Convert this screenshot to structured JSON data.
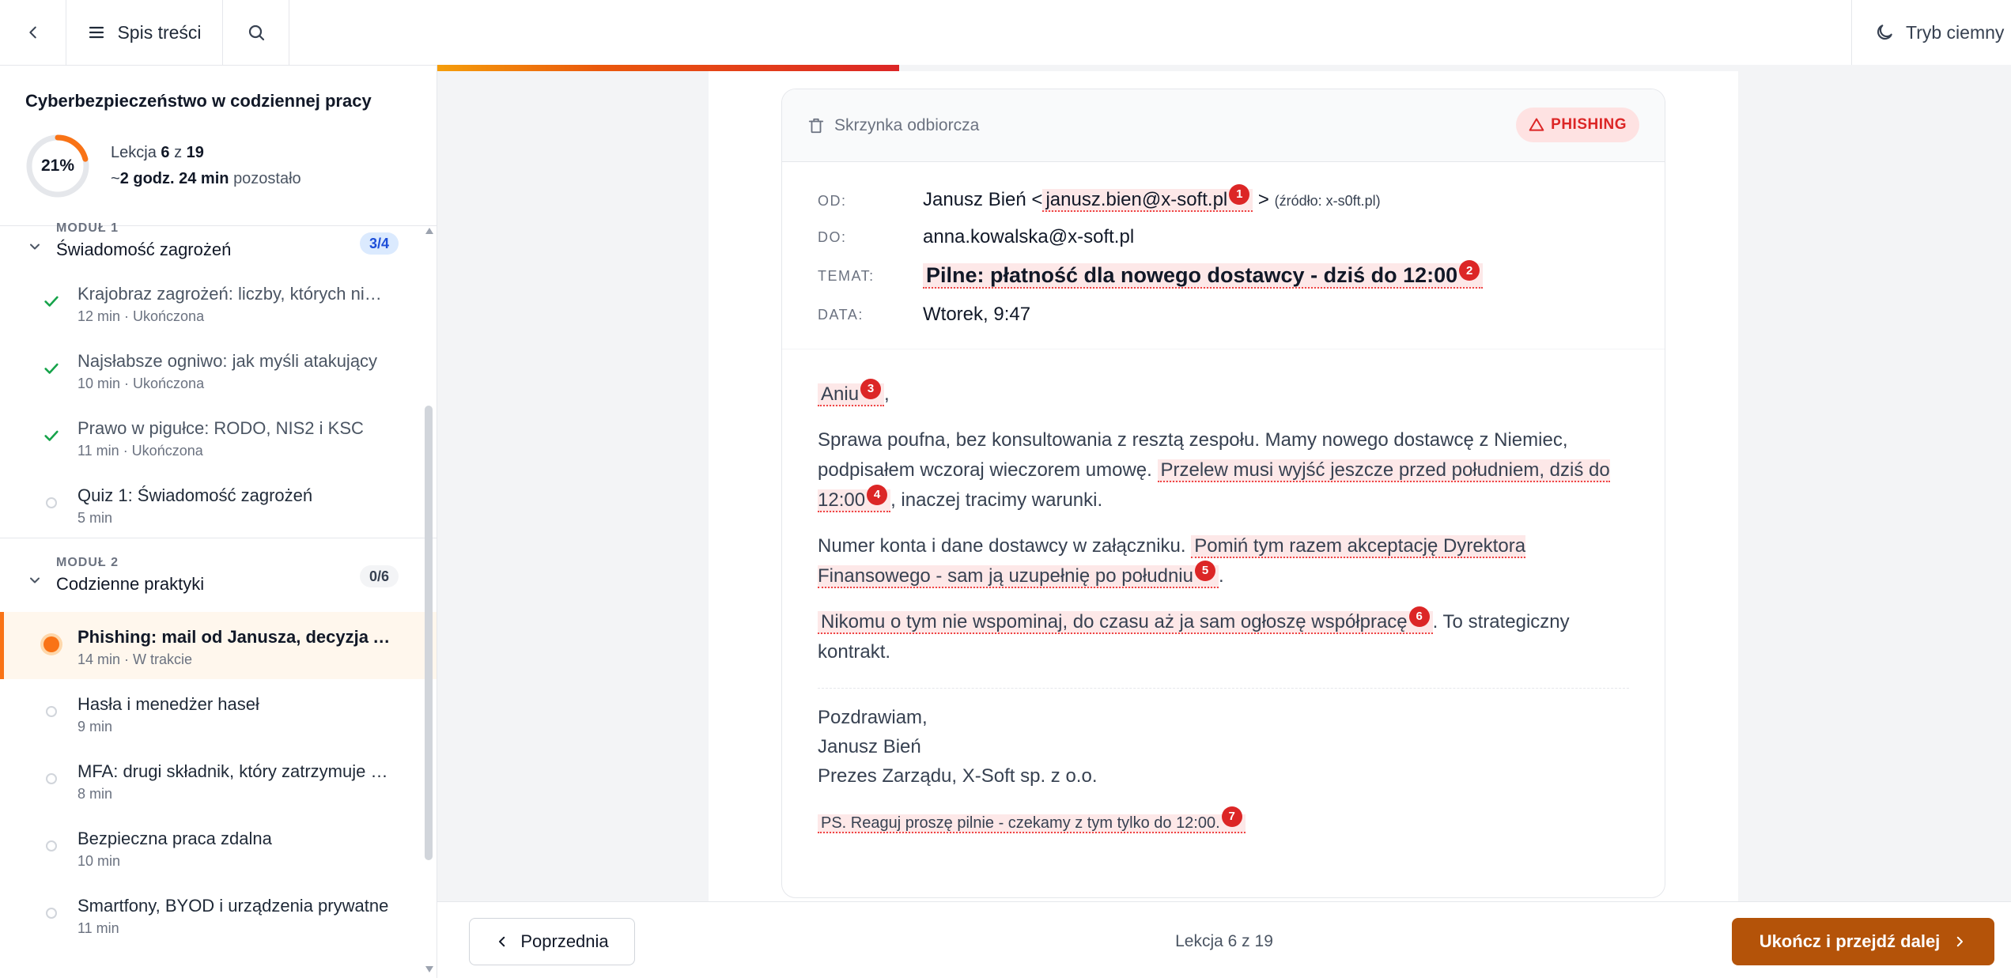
{
  "topbar": {
    "toc_label": "Spis treści",
    "dark_mode_label": "Tryb ciemny"
  },
  "progress": {
    "fraction": 0.2934
  },
  "sidebar": {
    "course_title": "Cyberbezpieczeństwo w codziennej pracy",
    "percent_label": "21%",
    "percent": 21,
    "lesson_word": "Lekcja",
    "lesson_current": "6",
    "of_word": "z",
    "lesson_total": "19",
    "time_prefix": "~",
    "time_left": "2 godz. 24 min",
    "time_suffix": "pozostało",
    "modules": [
      {
        "label": "MODUŁ 1",
        "name": "Świadomość zagrożeń",
        "badge": "3/4",
        "lessons": [
          {
            "title": "Krajobraz zagrożeń: liczby, których ni…",
            "meta": "12 min · Ukończona",
            "status": "done"
          },
          {
            "title": "Najsłabsze ogniwo: jak myśli atakujący",
            "meta": "10 min · Ukończona",
            "status": "done"
          },
          {
            "title": "Prawo w pigułce: RODO, NIS2 i KSC",
            "meta": "11 min · Ukończona",
            "status": "done"
          },
          {
            "title": "Quiz 1: Świadomość zagrożeń",
            "meta": "5 min",
            "status": "todo"
          }
        ]
      },
      {
        "label": "MODUŁ 2",
        "name": "Codzienne praktyki",
        "badge": "0/6",
        "lessons": [
          {
            "title": "Phishing: mail od Janusza, decyzja A…",
            "meta": "14 min · W trakcie",
            "status": "active"
          },
          {
            "title": "Hasła i menedżer haseł",
            "meta": "9 min",
            "status": "todo"
          },
          {
            "title": "MFA: drugi składnik, który zatrzymuje …",
            "meta": "8 min",
            "status": "todo"
          },
          {
            "title": "Bezpieczna praca zdalna",
            "meta": "10 min",
            "status": "todo"
          },
          {
            "title": "Smartfony, BYOD i urządzenia prywatne",
            "meta": "11 min",
            "status": "todo"
          }
        ]
      }
    ]
  },
  "email": {
    "inbox_label": "Skrzynka odbiorcza",
    "phishing_badge": "PHISHING",
    "from_key": "OD:",
    "from_name": "Janusz Bień <",
    "from_address": "janusz.bien@x-soft.pl",
    "from_close": ">",
    "from_source": "(źródło: x-s0ft.pl)",
    "to_key": "DO:",
    "to_value": "anna.kowalska@x-soft.pl",
    "subject_key": "TEMAT:",
    "subject_value": "Pilne: płatność dla nowego dostawcy - dziś do 12:00",
    "date_key": "DATA:",
    "date_value": "Wtorek, 9:47",
    "greeting": "Aniu",
    "greeting_punct": ",",
    "p1_a": "Sprawa poufna, bez konsultowania z resztą zespołu. Mamy nowego dostawcę z Niemiec, podpisałem wczoraj wieczorem umowę.",
    "p1_mark": "Przelew musi wyjść jeszcze przed południem, dziś do 12:00",
    "p1_b": ", inaczej tracimy warunki.",
    "p2_a": "Numer konta i dane dostawcy w załączniku.",
    "p2_mark": "Pomiń tym razem akceptację Dyrektora Finansowego - sam ją uzupełnię po południu",
    "p2_b": ".",
    "p3_mark": "Nikomu o tym nie wspominaj, do czasu aż ja sam ogłoszę współpracę",
    "p3_b": ". To strategiczny kontrakt.",
    "sig_1": "Pozdrawiam,",
    "sig_2": "Janusz Bień",
    "sig_3": "Prezes Zarządu, X-Soft sp. z o.o.",
    "ps": "PS. Reaguj proszę pilnie - czekamy z tym tylko do 12:00.",
    "markers": [
      "1",
      "2",
      "3",
      "4",
      "5",
      "6",
      "7"
    ]
  },
  "footer": {
    "prev_label": "Poprzednia",
    "counter": "Lekcja 6 z 19",
    "next_label": "Ukończ i przejdź dalej"
  },
  "colors": {
    "accent": "#f97316",
    "next_button": "#b45309",
    "phishing_red": "#dc2626",
    "done_green": "#16a34a"
  }
}
